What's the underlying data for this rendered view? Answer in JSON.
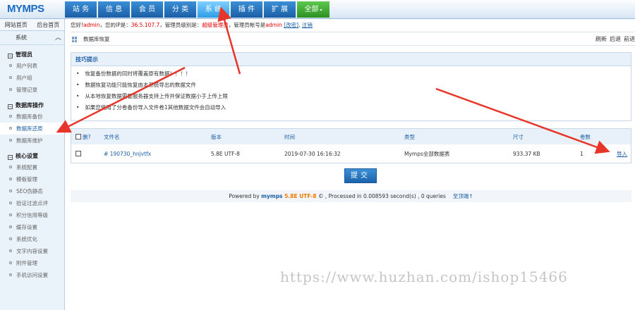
{
  "logo": {
    "main": "MYMPS",
    "accent": ""
  },
  "nav": [
    {
      "label": "站 务",
      "active": false
    },
    {
      "label": "信 息",
      "active": false
    },
    {
      "label": "会 员",
      "active": false
    },
    {
      "label": "分 类",
      "active": false
    },
    {
      "label": "系 统",
      "active": true
    },
    {
      "label": "插 件",
      "active": false
    },
    {
      "label": "扩 展",
      "active": false
    }
  ],
  "nav_all": {
    "label": "全部",
    "caret": "▾"
  },
  "sidebar": {
    "link_site": "网站首页",
    "link_admin": "后台首页",
    "heading": "系统",
    "chevron": "︿",
    "groups": [
      {
        "title": "管理员",
        "toggle": "−",
        "items": [
          "用户列表",
          "用户组",
          "管理记录"
        ]
      },
      {
        "title": "数据库操作",
        "toggle": "−",
        "items": [
          "数据库备份",
          "数据库还原",
          "数据库维护"
        ]
      },
      {
        "title": "核心设置",
        "toggle": "−",
        "items": [
          "系统配置",
          "模板管理",
          "SEO伪静态",
          "验证过滤点评",
          "积分信用等级",
          "缓存设置",
          "系统优化",
          "文字内容设置",
          "附件管理",
          "手机访问设置"
        ]
      }
    ],
    "active_item": "数据库还原"
  },
  "info": {
    "hello": "您好!",
    "user": "admin",
    "ip_label": "，您的IP是：",
    "ip": "36.5.107.7",
    "role_label": "，管理员级别是：",
    "role": "超级管理员",
    "account_label": "，管理员帐号是",
    "account": "admin",
    "change_pwd": "[改密]",
    "logout": "注销"
  },
  "breadcrumb": {
    "title": "数据库恢复",
    "refresh": "刷新",
    "back": "后退",
    "forward": "前进"
  },
  "tips": {
    "title": "技巧提示",
    "items": [
      "恢复备份数据的同时将覆盖原有数据！！！！",
      "数据恢复功能只能恢复由本系统导出的数据文件",
      "从本地恢复数据需要服务器支持上传并保证数据小于上传上限",
      "如果您使用了分卷备份导入文件卷1其他数据文件会自动导入"
    ]
  },
  "table": {
    "headers": {
      "check": "删?",
      "filename": "文件名",
      "version": "版本",
      "time": "时间",
      "type": "类型",
      "size": "尺寸",
      "volumes": "卷数",
      "action": ""
    },
    "rows": [
      {
        "filename": "190730_hnjvtfx",
        "icon": "#",
        "version": "5.8E UTF-8",
        "time": "2019-07-30 16:16:32",
        "type": "Mymps全部数据表",
        "size": "933.37 KB",
        "volumes": "1",
        "action": "导入"
      }
    ]
  },
  "submit_label": "提交",
  "footer": {
    "powered": "Powered by ",
    "brand": "mymps",
    "version": " 5.8E UTF-8",
    "rest": " © , Processed in 0.008593 second(s) , 0 queries",
    "top_link": "至顶端↑"
  },
  "watermark": "https://www.huzhan.com/ishop15466"
}
